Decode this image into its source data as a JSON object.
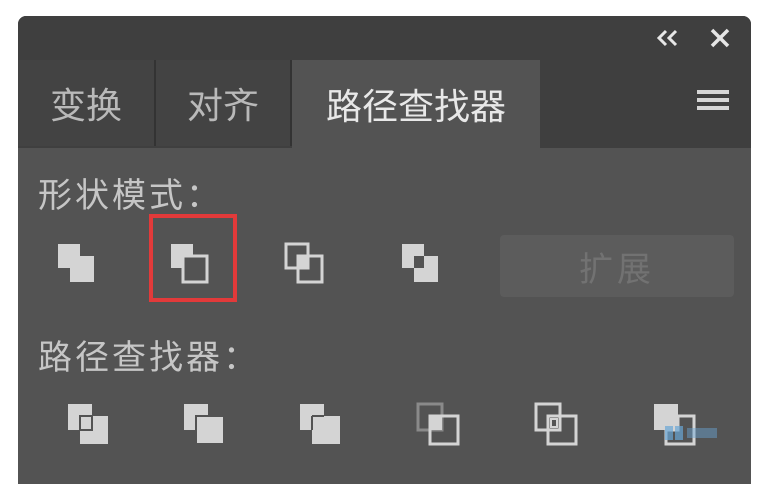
{
  "titlebar": {
    "collapse_icon": "double-chevron-left-icon",
    "close_icon": "close-icon"
  },
  "tabs": [
    {
      "label": "变换",
      "active": false
    },
    {
      "label": "对齐",
      "active": false
    },
    {
      "label": "路径查找器",
      "active": true
    }
  ],
  "menu_icon": "hamburger-menu-icon",
  "shape_modes": {
    "label": "形状模式：",
    "buttons": [
      {
        "name": "unite-icon"
      },
      {
        "name": "minus-front-icon",
        "highlighted": true
      },
      {
        "name": "intersect-icon"
      },
      {
        "name": "exclude-icon"
      }
    ],
    "expand_label": "扩展"
  },
  "pathfinders": {
    "label": "路径查找器：",
    "buttons": [
      {
        "name": "divide-icon"
      },
      {
        "name": "trim-icon"
      },
      {
        "name": "merge-icon"
      },
      {
        "name": "crop-icon"
      },
      {
        "name": "outline-icon"
      },
      {
        "name": "minus-back-icon"
      }
    ]
  },
  "colors": {
    "panel_bg": "#535353",
    "tab_bg": "#3f3f3f",
    "icon_fill": "#d4d4d4",
    "highlight": "#e23a3a"
  }
}
